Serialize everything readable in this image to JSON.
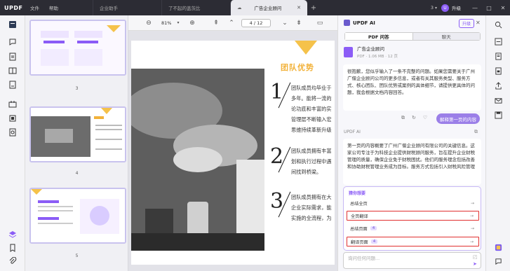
{
  "app": {
    "logo": "UPDF",
    "menu": [
      "文件",
      "帮助"
    ]
  },
  "tabs": [
    {
      "label": "企业助手",
      "active": false
    },
    {
      "label": "了不起的盖茨比",
      "active": false
    },
    {
      "label": "广告企业顾问",
      "active": true
    }
  ],
  "titlebar": {
    "count": "3",
    "avatar_letter": "U",
    "upgrade": "升级",
    "minimize": "—",
    "maximize": "□",
    "close": "✕"
  },
  "toolbar": {
    "zoom": "81%",
    "page_current": "4",
    "page_total": "/ 12",
    "page_display": "4  /  12"
  },
  "thumbnails": [
    {
      "num": "3"
    },
    {
      "num": "4"
    },
    {
      "num": "5"
    }
  ],
  "document": {
    "title": "团队优势",
    "items": [
      {
        "num": "1",
        "lines": [
          "团队成员均毕业于",
          "多年。能将一流的",
          "论功底和丰富的实",
          "管理层不断输入宏",
          "思维持续革新升级"
        ]
      },
      {
        "num": "2",
        "lines": [
          "团队成员拥有丰富",
          "划和执行过程中遇",
          "间找到桥梁。"
        ]
      },
      {
        "num": "3",
        "lines": [
          "团队成员拥有在大",
          "企业实际需求，能",
          "实施的全流程，为"
        ]
      }
    ]
  },
  "ai": {
    "title": "UPDF AI",
    "upgrade": "升级",
    "tabs": [
      "PDF 问答",
      "聊天"
    ],
    "doc_name": "广告企业顾问",
    "doc_meta": "PDF · 1.06 MB · 12 页",
    "greeting": "很抱歉，您似乎输入了一条不完整的问题。如果您需要关于广州广偃企业顾问公司的更多信息，或者有关其服务类型、服务方式、核心团队、团队优势或案例的具体细节，请提供更具体的问题，我会根据文档内容回答。",
    "summary_button": "解释第一页的内容",
    "ai_label": "UPDF AI",
    "answer": "第一页的内容概要了广州广偃企业顾问有限公司的关键信息。这家公司专注于为科技企业提供财税顾问服务，旨在提升企业财税管理的质量，确保企业免于财税困扰。他们的服务理念包括改善和协助财税管理业务成为目标。服务方式包括引入财税风险管理",
    "suggest_title": "猜你想要",
    "suggestions": [
      {
        "label": "总结全页",
        "badge": ""
      },
      {
        "label": "全页翻译",
        "badge": ""
      },
      {
        "label": "总结页面",
        "badge": "4"
      },
      {
        "label": "翻译页面",
        "badge": "4"
      }
    ],
    "input_placeholder": "询问任何问题..."
  }
}
